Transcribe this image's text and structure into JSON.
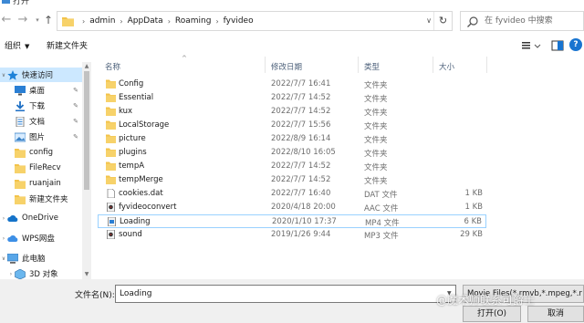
{
  "window": {
    "title": "打开"
  },
  "address": {
    "crumbs": [
      "admin",
      "AppData",
      "Roaming",
      "fyvideo"
    ]
  },
  "search": {
    "placeholder": "在 fyvideo 中搜索"
  },
  "toolbar": {
    "organize_label": "组织",
    "new_folder_label": "新建文件夹",
    "help_label": "?"
  },
  "sidebar": {
    "items": [
      {
        "label": "快速访问",
        "icon": "star-icon",
        "pinned": false
      },
      {
        "label": "桌面",
        "icon": "desktop-icon",
        "pinned": true
      },
      {
        "label": "下载",
        "icon": "download-icon",
        "pinned": true
      },
      {
        "label": "文档",
        "icon": "document-icon",
        "pinned": true
      },
      {
        "label": "图片",
        "icon": "pictures-icon",
        "pinned": true
      },
      {
        "label": "config",
        "icon": "folder-icon",
        "pinned": false
      },
      {
        "label": "FileRecv",
        "icon": "folder-icon",
        "pinned": false
      },
      {
        "label": "ruanjain",
        "icon": "folder-icon",
        "pinned": false
      },
      {
        "label": "新建文件夹",
        "icon": "folder-icon",
        "pinned": false
      },
      {
        "label": "OneDrive",
        "icon": "cloud-icon",
        "pinned": false
      },
      {
        "label": "WPS网盘",
        "icon": "wps-cloud-icon",
        "pinned": false
      },
      {
        "label": "此电脑",
        "icon": "computer-icon",
        "pinned": false
      },
      {
        "label": "3D 对象",
        "icon": "3d-objects-icon",
        "pinned": false
      }
    ]
  },
  "columns": {
    "name": "名称",
    "date": "修改日期",
    "type": "类型",
    "size": "大小"
  },
  "files": [
    {
      "name": "Config",
      "date": "2022/7/7 16:41",
      "type": "文件夹",
      "size": "",
      "icon": "folder-icon"
    },
    {
      "name": "Essential",
      "date": "2022/7/7 14:52",
      "type": "文件夹",
      "size": "",
      "icon": "folder-icon"
    },
    {
      "name": "kux",
      "date": "2022/7/7 14:52",
      "type": "文件夹",
      "size": "",
      "icon": "folder-icon"
    },
    {
      "name": "LocalStorage",
      "date": "2022/7/7 15:56",
      "type": "文件夹",
      "size": "",
      "icon": "folder-icon"
    },
    {
      "name": "picture",
      "date": "2022/8/9 16:14",
      "type": "文件夹",
      "size": "",
      "icon": "folder-icon"
    },
    {
      "name": "plugins",
      "date": "2022/8/10 16:05",
      "type": "文件夹",
      "size": "",
      "icon": "folder-icon"
    },
    {
      "name": "tempA",
      "date": "2022/7/7 14:52",
      "type": "文件夹",
      "size": "",
      "icon": "folder-icon"
    },
    {
      "name": "tempMerge",
      "date": "2022/7/7 14:52",
      "type": "文件夹",
      "size": "",
      "icon": "folder-icon"
    },
    {
      "name": "cookies.dat",
      "date": "2022/7/7 16:40",
      "type": "DAT 文件",
      "size": "1 KB",
      "icon": "file-icon"
    },
    {
      "name": "fyvideoconvert",
      "date": "2020/4/18 20:00",
      "type": "AAC 文件",
      "size": "1 KB",
      "icon": "audio-file-icon"
    },
    {
      "name": "Loading",
      "date": "2020/1/10 17:37",
      "type": "MP4 文件",
      "size": "6 KB",
      "icon": "video-file-icon",
      "selected": true
    },
    {
      "name": "sound",
      "date": "2019/1/26 9:44",
      "type": "MP3 文件",
      "size": "29 KB",
      "icon": "audio-file-icon"
    }
  ],
  "footer": {
    "filename_label": "文件名(N):",
    "filename_value": "Loading",
    "filetype_value": "Movie Files(*.rmvb,*.mpeg,*.r",
    "open_label": "打开(O)",
    "cancel_label": "取消"
  },
  "watermark": "@魔术师联系可爵士",
  "colors": {
    "folder": "#f3c34a",
    "selection": "#cce8ff",
    "accent": "#1874d0"
  }
}
